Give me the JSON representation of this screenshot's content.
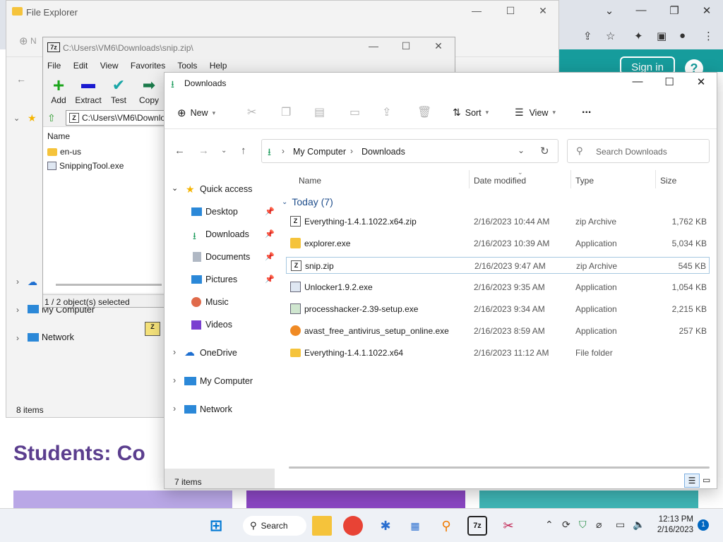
{
  "browser": {
    "signin_label": "Sign in",
    "help_label": "?",
    "page_heading": "Students: Co"
  },
  "back_explorer": {
    "title": "File Explorer",
    "nav_items": [
      "My Computer",
      "Network"
    ],
    "status": "8 items"
  },
  "sevenzip": {
    "title_icon": "7z",
    "title": "C:\\Users\\VM6\\Downloads\\snip.zip\\",
    "menu": [
      "File",
      "Edit",
      "View",
      "Favorites",
      "Tools",
      "Help"
    ],
    "toolbar": [
      "Add",
      "Extract",
      "Test",
      "Copy"
    ],
    "path": "C:\\Users\\VM6\\Downlo",
    "column_name": "Name",
    "files": [
      "en-us",
      "SnippingTool.exe"
    ],
    "status": "1 / 2 object(s) selected"
  },
  "explorer": {
    "title": "Downloads",
    "cmd_new": "New",
    "cmd_sort": "Sort",
    "cmd_view": "View",
    "cmd_more": "...",
    "breadcrumb": [
      "My Computer",
      "Downloads"
    ],
    "search_placeholder": "Search Downloads",
    "nav": {
      "quick_access": "Quick access",
      "desktop": "Desktop",
      "downloads": "Downloads",
      "documents": "Documents",
      "pictures": "Pictures",
      "music": "Music",
      "videos": "Videos",
      "onedrive": "OneDrive",
      "my_computer": "My Computer",
      "network": "Network"
    },
    "columns": {
      "name": "Name",
      "date": "Date modified",
      "type": "Type",
      "size": "Size"
    },
    "group": "Today (7)",
    "files": [
      {
        "name": "Everything-1.4.1.1022.x64.zip",
        "date": "2/16/2023 10:44 AM",
        "type": "zip Archive",
        "size": "1,762 KB",
        "icon": "zip-icon"
      },
      {
        "name": "explorer.exe",
        "date": "2/16/2023 10:39 AM",
        "type": "Application",
        "size": "5,034 KB",
        "icon": "exe-icon"
      },
      {
        "name": "snip.zip",
        "date": "2/16/2023 9:47 AM",
        "type": "zip Archive",
        "size": "545 KB",
        "icon": "zip-icon"
      },
      {
        "name": "Unlocker1.9.2.exe",
        "date": "2/16/2023 9:35 AM",
        "type": "Application",
        "size": "1,054 KB",
        "icon": "exe-icon"
      },
      {
        "name": "processhacker-2.39-setup.exe",
        "date": "2/16/2023 9:34 AM",
        "type": "Application",
        "size": "2,215 KB",
        "icon": "exe-icon"
      },
      {
        "name": "avast_free_antivirus_setup_online.exe",
        "date": "2/16/2023 8:59 AM",
        "type": "Application",
        "size": "257 KB",
        "icon": "exe-icon"
      },
      {
        "name": "Everything-1.4.1.1022.x64",
        "date": "2/16/2023 11:12 AM",
        "type": "File folder",
        "size": "",
        "icon": "folder-icon"
      }
    ],
    "status": "7 items"
  },
  "taskbar": {
    "search_label": "Search",
    "sevenzip_icon": "7z",
    "time": "12:13 PM",
    "date": "2/16/2023",
    "notification_count": "1"
  }
}
